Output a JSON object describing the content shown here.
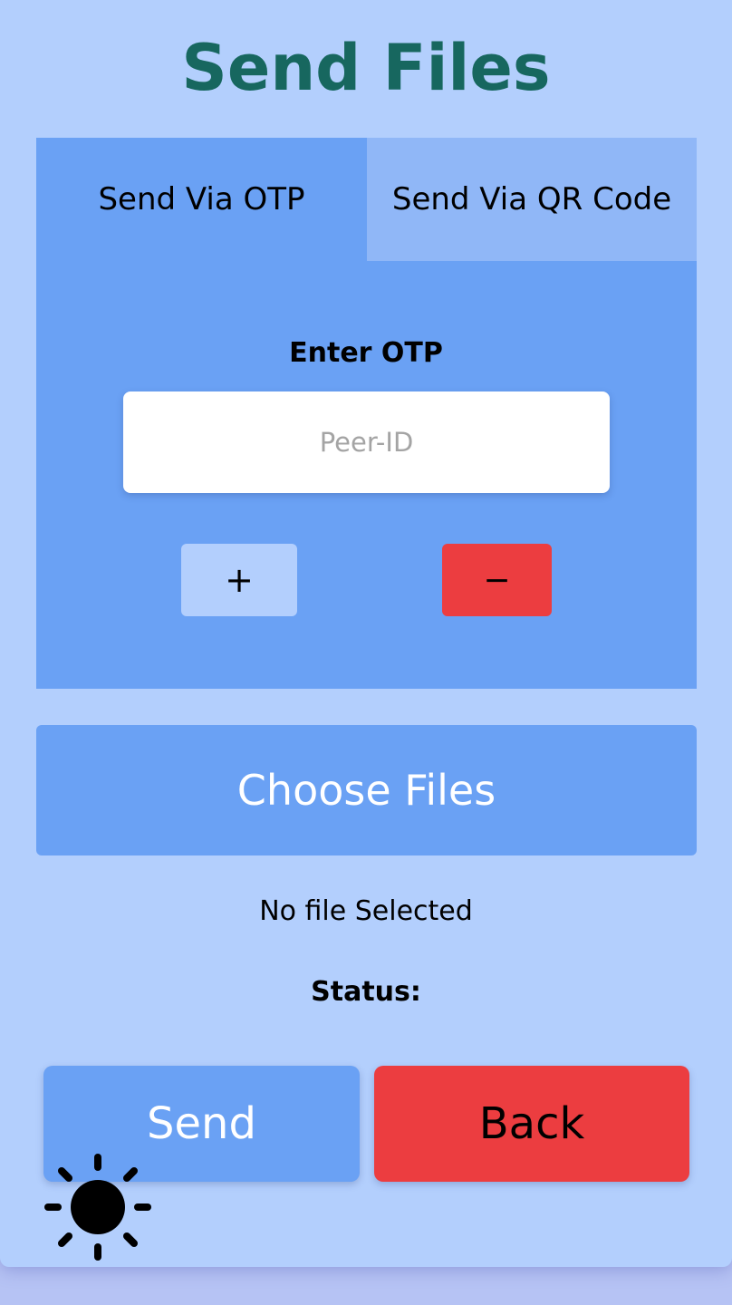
{
  "page": {
    "title": "Send Files"
  },
  "tabs": {
    "otp_label": "Send Via OTP",
    "qr_label": "Send Via QR Code",
    "active": "otp"
  },
  "otp": {
    "label": "Enter OTP",
    "input_value": "",
    "input_placeholder": "Peer-ID",
    "add_label": "+",
    "remove_label": "−"
  },
  "files": {
    "choose_label": "Choose Files",
    "selected_text": "No file Selected"
  },
  "status": {
    "label": "Status:",
    "value": ""
  },
  "actions": {
    "send_label": "Send",
    "back_label": "Back"
  },
  "theme": {
    "icon": "sun-icon"
  },
  "colors": {
    "title": "#17675f",
    "background": "#b3cffd",
    "primary": "#6aa1f4",
    "inactive_tab": "#90b7f7",
    "danger": "#ec3d40"
  }
}
